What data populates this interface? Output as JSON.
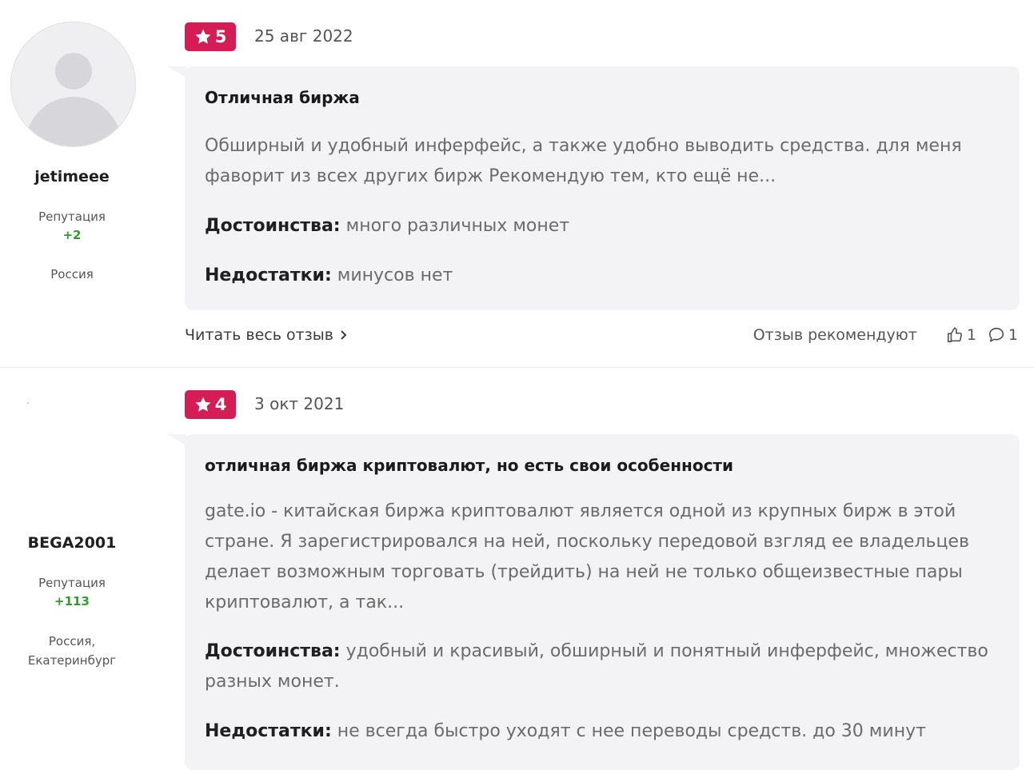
{
  "reviews": [
    {
      "user": {
        "name": "jetimeee",
        "reputation_label": "Репутация",
        "reputation_value": "+2",
        "location": "Россия"
      },
      "rating": "5",
      "date": "25 авг 2022",
      "title": "Отличная биржа",
      "text": "Обширный и удобный инферфейс, а также удобно выводить средства. для меня фаворит из всех других бирж Рекомендую тем, кто ещё не...",
      "pros_label": "Достоинства:",
      "pros": "много различных монет",
      "cons_label": "Недостатки:",
      "cons": "минусов нет",
      "read_more": "Читать весь отзыв",
      "recommend_label": "Отзыв рекомендуют",
      "likes": "1",
      "comments": "1"
    },
    {
      "user": {
        "name": "BEGA2001",
        "reputation_label": "Репутация",
        "reputation_value": "+113",
        "location_line1": "Россия,",
        "location_line2": "Екатеринбург"
      },
      "rating": "4",
      "date": "3 окт 2021",
      "title": "отличная биржа криптовалют, но есть свои особенности",
      "text": "gate.io - китайская биржа криптовалют является одной из крупных бирж в этой стране. Я зарегистрировался на ней, поскольку передовой взгляд ее владельцев делает возможным торговать (трейдить) на ней не только общеизвестные пары криптовалют, а так...",
      "pros_label": "Достоинства:",
      "pros": "удобный и красивый, обширный и понятный инферфейс, множество разных монет.",
      "cons_label": "Недостатки:",
      "cons": "не всегда быстро уходят с нее переводы средств. до 30 минут"
    }
  ],
  "colors": {
    "rating_badge": "#d41d54",
    "reputation_positive": "#2e9d2e",
    "bubble_bg": "#f3f3f5"
  },
  "icons": [
    "star-icon",
    "chevron-right-icon",
    "thumbs-up-icon",
    "comment-icon",
    "avatar-placeholder-icon"
  ]
}
